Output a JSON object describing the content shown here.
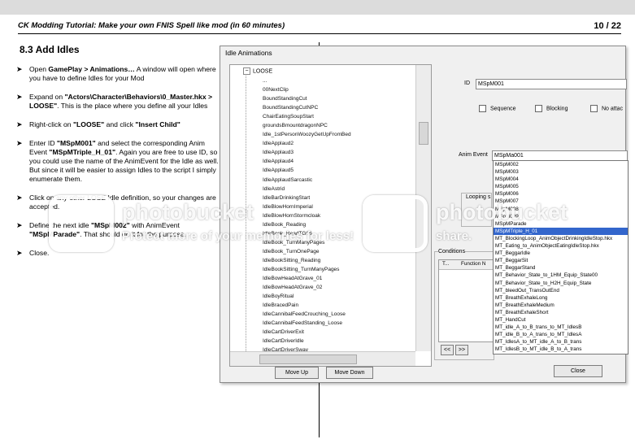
{
  "header": {
    "title": "CK Modding Tutorial: Make your own FNIS Spell like mod (in 60 minutes)",
    "page": "10 / 22"
  },
  "section_title": "8.3  Add Idles",
  "steps": [
    [
      "Open ",
      "GamePlay  >  Animations…",
      " A window will open where you have to define Idles for your Mod"
    ],
    [
      "Expand on ",
      "\"Actors\\Character\\Behaviors\\0_Master.hkx  >  LOOSE\"",
      ". This is the place where you define all your Idles"
    ],
    [
      "Right-click on ",
      "\"LOOSE\"",
      " and click ",
      "\"Insert  Child\""
    ],
    [
      "Enter ID ",
      "\"MSpM001\"",
      " and select the corresponding Anim Event ",
      "\"MSpMTriple_H_01\"",
      ". Again you are free to use ID, so you could use the name of the AnimEvent for the Idle as well. But since it will be easier to assign Idles to the script I simply enumerate them."
    ],
    [
      "Click on any other LOSE Idle definition, so your changes are accepted."
    ],
    [
      "Define the next idle ",
      "\"MSpM002\"",
      " with AnimEvent ",
      "\"MSpMParade\"",
      ". That should do it for the purpose."
    ],
    [
      "Close."
    ]
  ],
  "dialog": {
    "title": "Idle Animations",
    "tree_root": "LOOSE",
    "tree_items": [
      "...",
      "00NextClip",
      "BoundStandingCut",
      "BoundStandingCutNPC",
      "ChairEatingSoupStart",
      "groundsBmountdragonNPC",
      "Idle_1stPersonWoozyGetUpFromBed",
      "IdleApplaud2",
      "IdleApplaud3",
      "IdleApplaud4",
      "IdleApplaud5",
      "IdleApplaudSarcastic",
      "IdleAstrid",
      "IdleBarDrinkingStart",
      "IdleBlowHornImperial",
      "IdleBlowHornStormcloak",
      "IdleBook_Reading",
      "IdleBook_ReadTG06",
      "IdleBook_TurnManyPages",
      "IdleBook_TurnOnePage",
      "IdleBookSitting_Reading",
      "IdleBookSitting_TurnManyPages",
      "IdleBowHeadAtGrave_01",
      "IdleBowHeadAtGrave_02",
      "IdleBoyRitual",
      "IdleBracedPain",
      "IdleCannibalFeedCrouching_Loose",
      "IdleCannibalFeedStanding_Loose",
      "IdleCartDriverExit",
      "IdleCartDriverIdle",
      "IdleCartDriverSway"
    ],
    "id_label": "ID",
    "id_value": "MSpM001",
    "checkboxes": [
      "Sequence",
      "Blocking",
      "No attac"
    ],
    "anim_event_label": "Anim Event",
    "anim_event_value": "MSpMa001",
    "anim_events": [
      "MSpM002",
      "MSpM003",
      "MSpM004",
      "MSpM005",
      "MSpM006",
      "MSpM007",
      "MSpM008",
      "MSpM009",
      "MSpMParade",
      "MSpMTriple_H_01",
      "MT_BlockingLoop_AnimObjectDrinkingIdleStop.hkx",
      "MT_Eating_to_AnimObjectEatingIdleStop.hkx",
      "MT_BeggarIdle",
      "MT_BeggarSit",
      "MT_BeggarStand",
      "MT_Behavior_State_to_1HM_Equip_State00",
      "MT_Behavior_State_to_H2H_Equip_State",
      "MT_bleedOut_TransOutEnd",
      "MT_BreathExhaleLong",
      "MT_BreathExhaleMedium",
      "MT_BreathExhaleShort",
      "MT_HandCut",
      "MT_idle_A_to_B_trans_to_MT_IdlesB",
      "MT_idle_B_to_A_trans_to_MT_IdlesA",
      "MT_IdlesA_to_MT_idle_A_to_B_trans",
      "MT_IdlesB_to_MT_idle_B_to_A_trans"
    ],
    "selected_anim_event_index": 9,
    "looping_label": "Looping s",
    "conditions_label": "Conditions",
    "cond_cols": [
      "T...",
      "Function N"
    ],
    "nav_prev": "<<",
    "nav_next": ">>",
    "move_up": "Move Up",
    "move_down": "Move Down",
    "close": "Close"
  },
  "watermark": {
    "brand": "photobucket",
    "tagline": "Protect more of your memories for less!",
    "share": "share."
  }
}
